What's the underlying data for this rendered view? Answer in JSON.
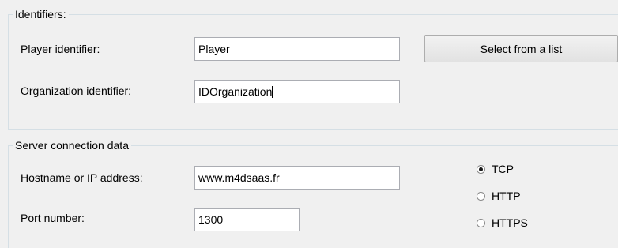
{
  "identifiers": {
    "legend": "Identifiers:",
    "player_label": "Player identifier:",
    "player_value": "Player",
    "organization_label": "Organization identifier:",
    "organization_value": "IDOrganization",
    "select_button": "Select from a list"
  },
  "server": {
    "legend": "Server connection data",
    "hostname_label": "Hostname or IP address:",
    "hostname_value": "www.m4dsaas.fr",
    "port_label": "Port number:",
    "port_value": "1300",
    "protocols": [
      {
        "label": "TCP",
        "selected": true
      },
      {
        "label": "HTTP",
        "selected": false
      },
      {
        "label": "HTTPS",
        "selected": false
      }
    ]
  }
}
